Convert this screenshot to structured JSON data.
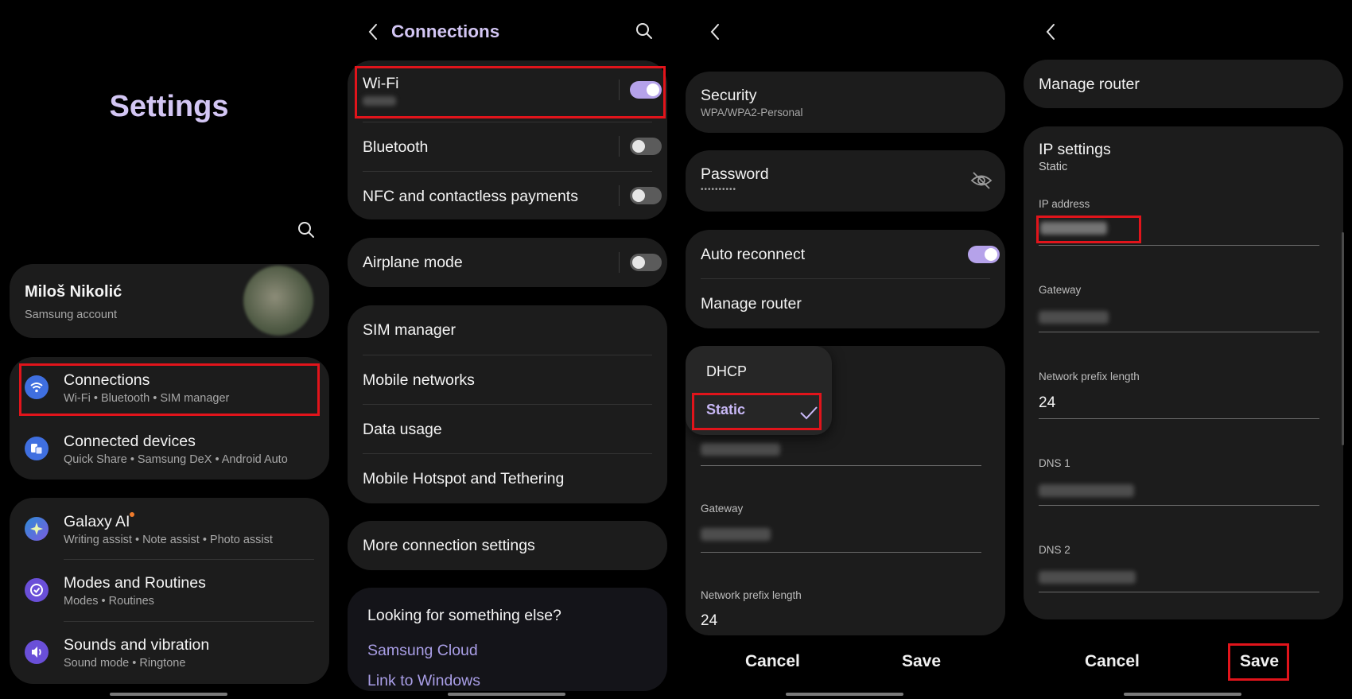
{
  "panel1": {
    "title": "Settings",
    "account": {
      "name": "Miloš Nikolić",
      "subtitle": "Samsung account"
    },
    "items": [
      {
        "label": "Connections",
        "sub": "Wi-Fi  •  Bluetooth  •  SIM manager",
        "icon": "wifi-icon",
        "color": "#3f6fe0"
      },
      {
        "label": "Connected devices",
        "sub": "Quick Share  •  Samsung DeX  •  Android Auto",
        "icon": "devices-icon",
        "color": "#3f6fe0"
      },
      {
        "label": "Galaxy AI",
        "sub": "Writing assist  •  Note assist  •  Photo assist",
        "icon": "galaxy-ai-icon",
        "color": "#3a7bd5"
      },
      {
        "label": "Modes and Routines",
        "sub": "Modes  •  Routines",
        "icon": "routines-icon",
        "color": "#6a4fd8"
      },
      {
        "label": "Sounds and vibration",
        "sub": "Sound mode  •  Ringtone",
        "icon": "sound-icon",
        "color": "#6a4fd8"
      }
    ]
  },
  "panel2": {
    "title": "Connections",
    "toggles": [
      {
        "label": "Wi-Fi",
        "state": "on"
      },
      {
        "label": "Bluetooth",
        "state": "off"
      },
      {
        "label": "NFC and contactless payments",
        "state": "off"
      },
      {
        "label": "Airplane mode",
        "state": "off"
      }
    ],
    "links": [
      "SIM manager",
      "Mobile networks",
      "Data usage",
      "Mobile Hotspot and Tethering"
    ],
    "more": "More connection settings",
    "looking": {
      "title": "Looking for something else?",
      "links": [
        "Samsung Cloud",
        "Link to Windows"
      ]
    }
  },
  "panel3": {
    "security_label": "Security",
    "security_value": "WPA/WPA2-Personal",
    "password_label": "Password",
    "password_value": "••••••••••",
    "auto_reconnect": "Auto reconnect",
    "manage_router": "Manage router",
    "dropdown": {
      "options": [
        "DHCP",
        "Static"
      ],
      "selected": "Static"
    },
    "gateway_label": "Gateway",
    "prefix_label": "Network prefix length",
    "prefix_value": "24",
    "cancel": "Cancel",
    "save": "Save"
  },
  "panel4": {
    "manage_router": "Manage router",
    "ip_settings_label": "IP settings",
    "ip_settings_value": "Static",
    "fields": [
      "IP address",
      "Gateway",
      "Network prefix length",
      "DNS 1",
      "DNS 2"
    ],
    "prefix_value": "24",
    "cancel": "Cancel",
    "save": "Save"
  },
  "colors": {
    "accent": "#b5a2ea",
    "highlight": "#e1141b",
    "card": "#1c1c1c"
  }
}
